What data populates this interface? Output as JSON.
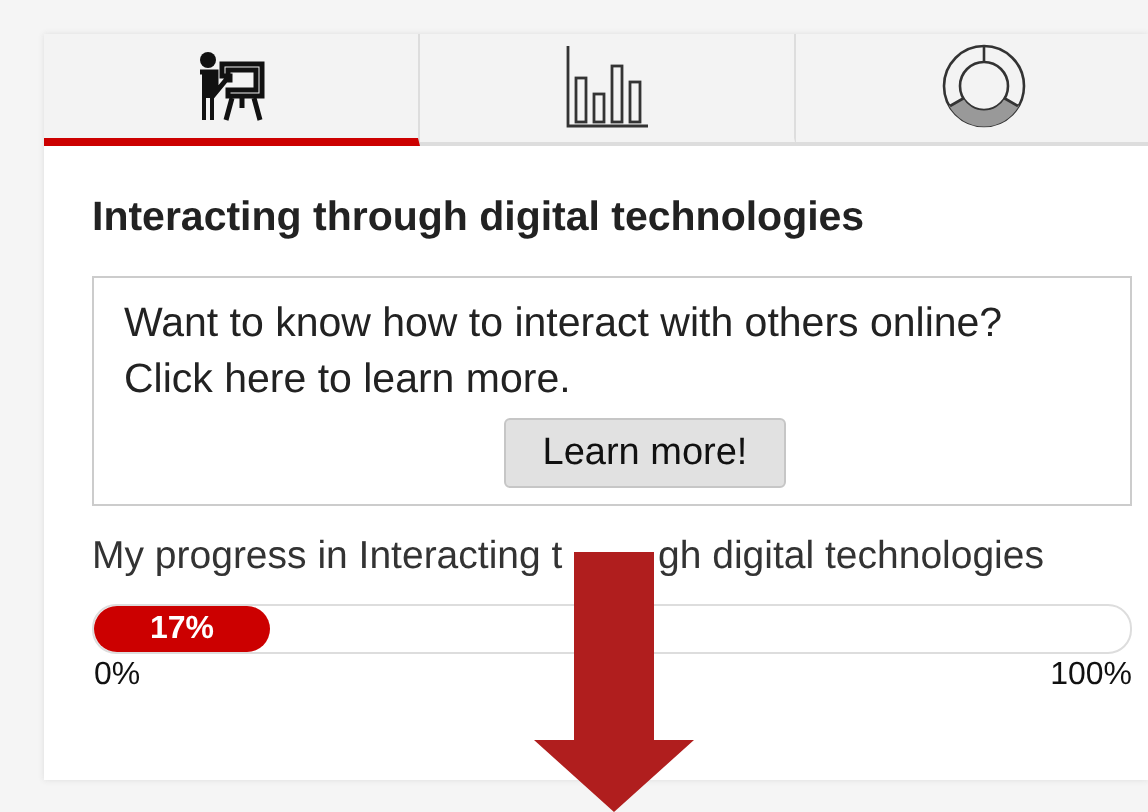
{
  "tabs": [
    {
      "kind": "presenter",
      "selected": true
    },
    {
      "kind": "bar-chart",
      "selected": false
    },
    {
      "kind": "donut",
      "selected": false
    }
  ],
  "heading": "Interacting through digital technologies",
  "info": {
    "text": "Want to know how to interact with others online? Click here to learn more.",
    "button": "Learn more!"
  },
  "progress": {
    "label_parts": [
      "My progress in Interacting t",
      "gh digital technologies"
    ],
    "level": 0.17,
    "reading": "17%",
    "min_label": "0%",
    "max_label": "100%"
  }
}
